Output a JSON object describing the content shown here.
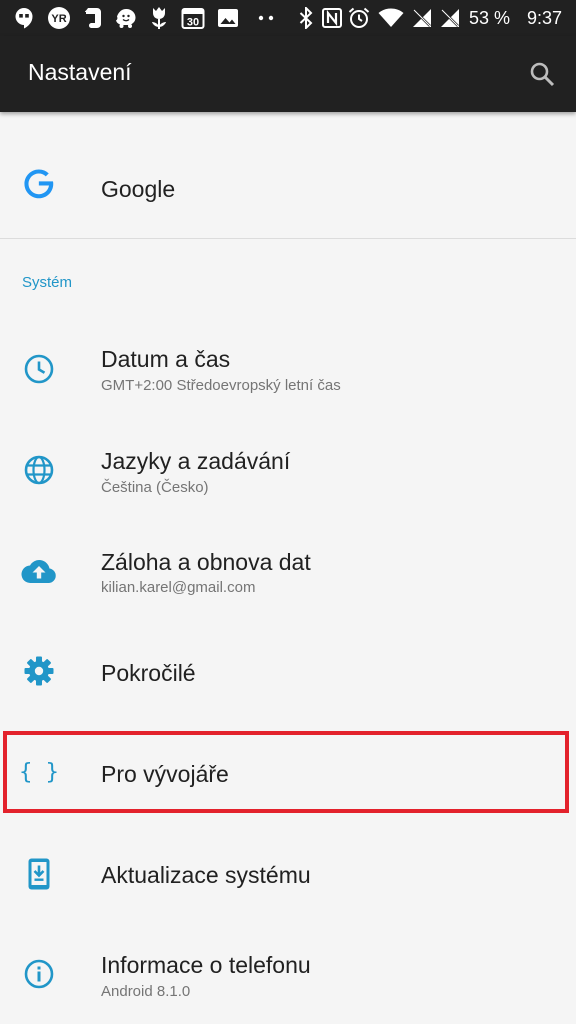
{
  "status_bar": {
    "battery": "53 %",
    "time": "9:37",
    "left_icons": [
      "hangouts-icon",
      "yr-icon",
      "evernote-icon",
      "waze-icon",
      "tulip-icon",
      "calendar-icon",
      "gallery-icon",
      "more-dots-icon"
    ],
    "calendar_day": "30",
    "right_icons": [
      "bluetooth-icon",
      "nfc-icon",
      "alarm-icon",
      "wifi-icon",
      "no-sim-icon",
      "no-sim-icon",
      "battery-icon"
    ]
  },
  "toolbar": {
    "title": "Nastavení",
    "search_icon": "search-icon"
  },
  "google": {
    "label": "Google",
    "icon": "google-icon"
  },
  "section_header": "Systém",
  "items": [
    {
      "label": "Datum a čas",
      "subtitle": "GMT+2:00 Středoevropský letní čas",
      "icon": "clock-icon"
    },
    {
      "label": "Jazyky a zadávání",
      "subtitle": "Čeština (Česko)",
      "icon": "globe-icon"
    },
    {
      "label": "Záloha a obnova dat",
      "subtitle": "kilian.karel@gmail.com",
      "icon": "cloud-upload-icon"
    },
    {
      "label": "Pokročilé",
      "subtitle": "",
      "icon": "gear-icon"
    },
    {
      "label": "Pro vývojáře",
      "subtitle": "",
      "icon": "braces-icon",
      "icon_glyph": "{ }"
    },
    {
      "label": "Aktualizace systému",
      "subtitle": "",
      "icon": "system-update-icon"
    },
    {
      "label": "Informace o telefonu",
      "subtitle": "Android 8.1.0",
      "icon": "info-icon"
    }
  ],
  "colors": {
    "accent": "#2196c8",
    "toolbar_bg": "#212121",
    "page_bg": "#f5f5f5",
    "highlight": "#e3222c"
  }
}
